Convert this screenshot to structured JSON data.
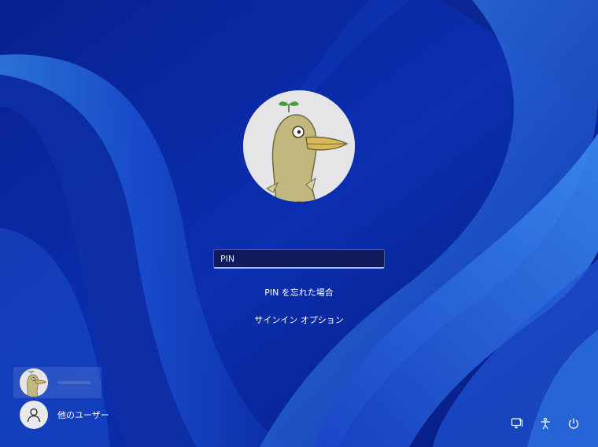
{
  "lock_screen": {
    "pin_field": {
      "placeholder": "PIN",
      "value": ""
    },
    "forgot_pin_link": "PIN を忘れた場合",
    "sign_in_options_link": "サインイン オプション"
  },
  "user_list": {
    "items": [
      {
        "avatar": "duck-avatar",
        "name": "",
        "selected": true
      },
      {
        "avatar": "person-icon",
        "name": "他のユーザー",
        "selected": false
      }
    ]
  },
  "system_icons": [
    "network-icon",
    "accessibility-icon",
    "power-icon"
  ],
  "colors": {
    "background": "#0a2a9c",
    "avatar_background": "#e5e5e8",
    "duck_body": "#c2b87e",
    "duck_beak": "#d9b85a",
    "input_underline": "#9dbcff"
  }
}
